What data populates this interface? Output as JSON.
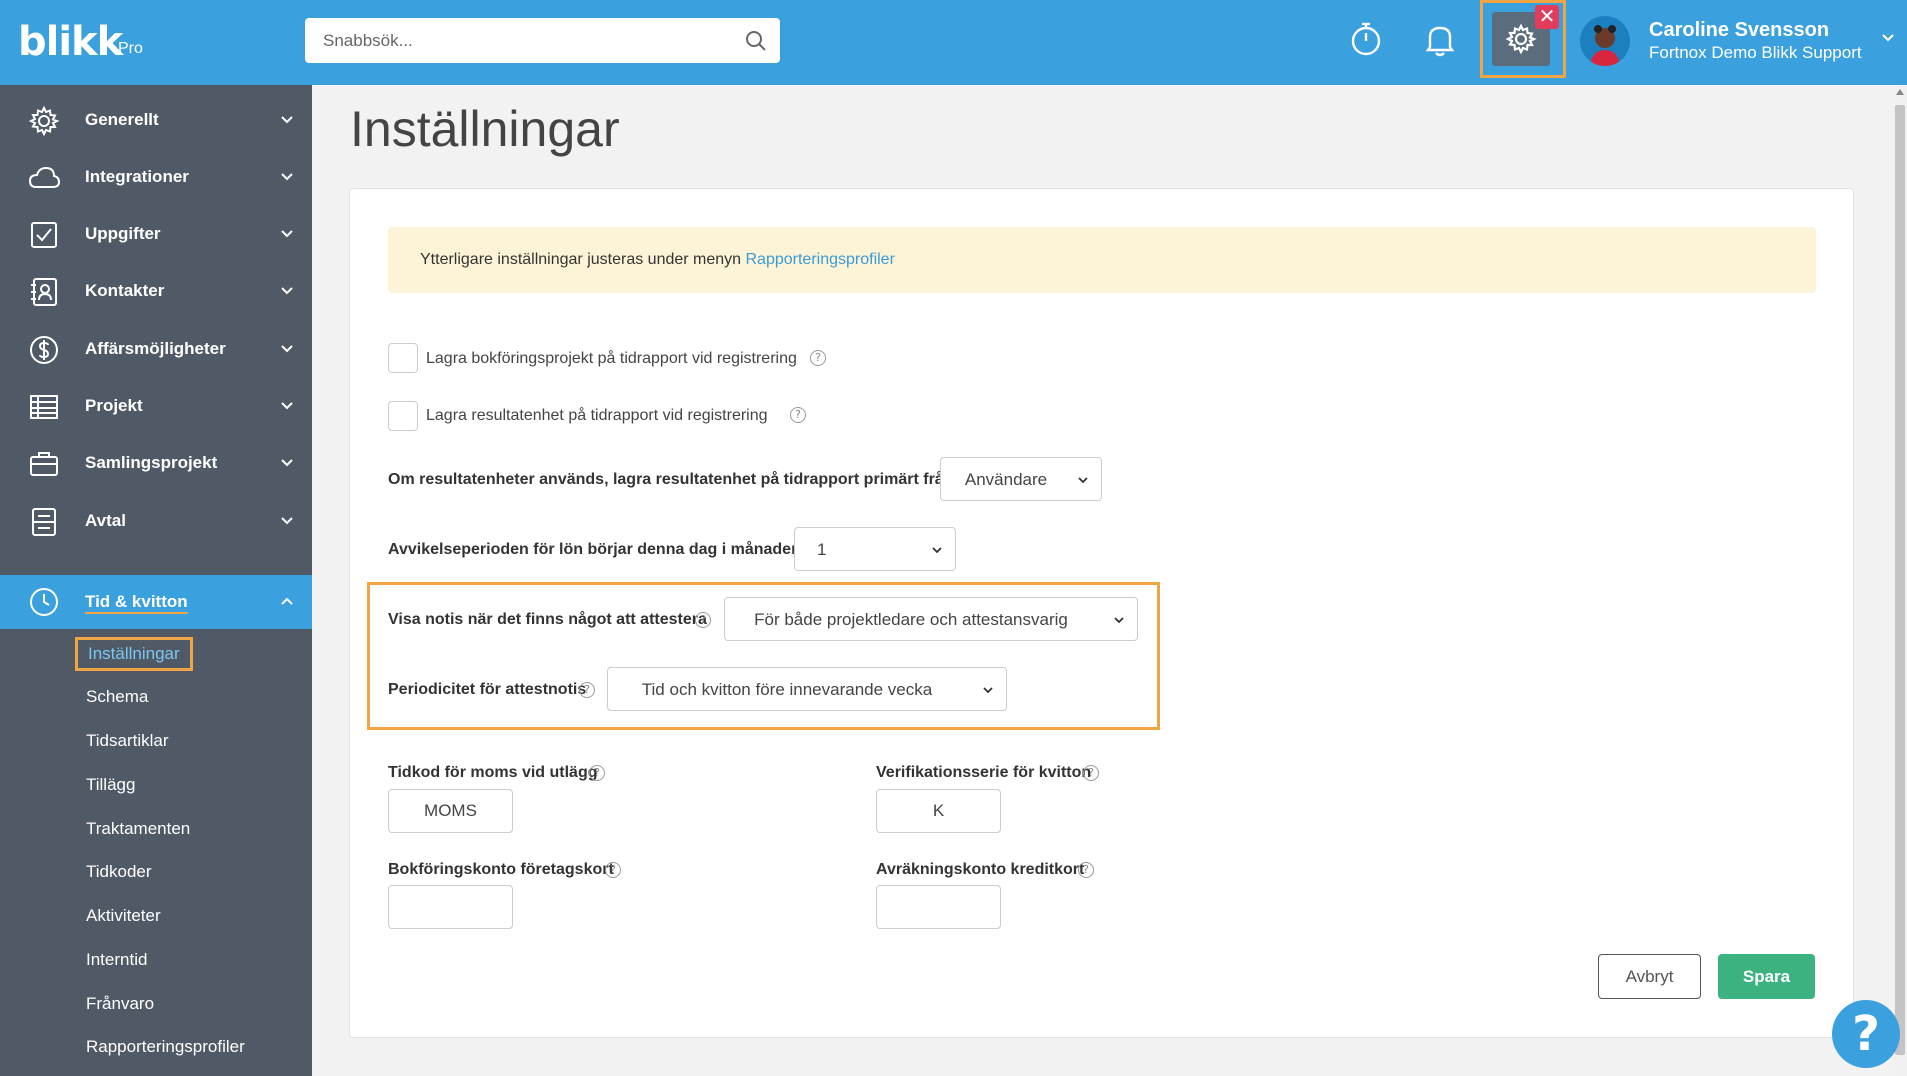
{
  "app": {
    "logo": "blikk",
    "logo_suffix": "Pro"
  },
  "search": {
    "placeholder": "Snabbsök..."
  },
  "topbar": {
    "timer_icon": "stopwatch-icon",
    "bell_icon": "bell-icon",
    "settings_icon": "gear-icon",
    "close_badge": "✕"
  },
  "user": {
    "name": "Caroline Svensson",
    "org": "Fortnox Demo Blikk Support"
  },
  "sidebar": {
    "items": [
      {
        "label": "Generellt",
        "icon": "gear-icon"
      },
      {
        "label": "Integrationer",
        "icon": "cloud-icon"
      },
      {
        "label": "Uppgifter",
        "icon": "checkbox-icon"
      },
      {
        "label": "Kontakter",
        "icon": "contact-card-icon"
      },
      {
        "label": "Affärsmöjligheter",
        "icon": "dollar-icon"
      },
      {
        "label": "Projekt",
        "icon": "table-icon"
      },
      {
        "label": "Samlingsprojekt",
        "icon": "briefcase-icon"
      },
      {
        "label": "Avtal",
        "icon": "document-icon"
      },
      {
        "label": "Tid & kvitton",
        "icon": "clock-icon"
      }
    ],
    "sub_items": [
      "Inställningar",
      "Schema",
      "Tidsartiklar",
      "Tillägg",
      "Traktamenten",
      "Tidkoder",
      "Aktiviteter",
      "Interntid",
      "Frånvaro",
      "Rapporteringsprofiler"
    ]
  },
  "page": {
    "title": "Inställningar"
  },
  "alert": {
    "text": "Ytterligare inställningar justeras under menyn ",
    "link": "Rapporteringsprofiler"
  },
  "form": {
    "checkbox1": "Lagra bokföringsprojekt på tidrapport vid registrering",
    "checkbox2": "Lagra resultatenhet på tidrapport vid registrering",
    "result_unit_label": "Om resultatenheter används, lagra resultatenhet på tidrapport primärt från",
    "result_unit_value": "Användare",
    "deviation_label": "Avvikelseperioden för lön börjar denna dag i månaden",
    "deviation_value": "1",
    "notify_label": "Visa notis när det finns något att attestera",
    "notify_value": "För både projektledare och attestansvarig",
    "periodicity_label": "Periodicitet för attestnotis",
    "periodicity_value": "Tid och kvitton före innevarande vecka",
    "vat_label": "Tidkod för moms vid utlägg",
    "vat_value": "MOMS",
    "voucher_label": "Verifikationsserie för kvitton",
    "voucher_value": "K",
    "account_label": "Bokföringskonto företagskort",
    "account_value": "",
    "credit_label": "Avräkningskonto kreditkort",
    "credit_value": "",
    "cancel": "Avbryt",
    "save": "Spara"
  },
  "help_fab": "?",
  "colors": {
    "topbar": "#3aa0de",
    "sidebar": "#4f5a66",
    "highlight": "#f0a545",
    "save": "#3bb27f",
    "alert_bg": "#fdf4d7"
  }
}
